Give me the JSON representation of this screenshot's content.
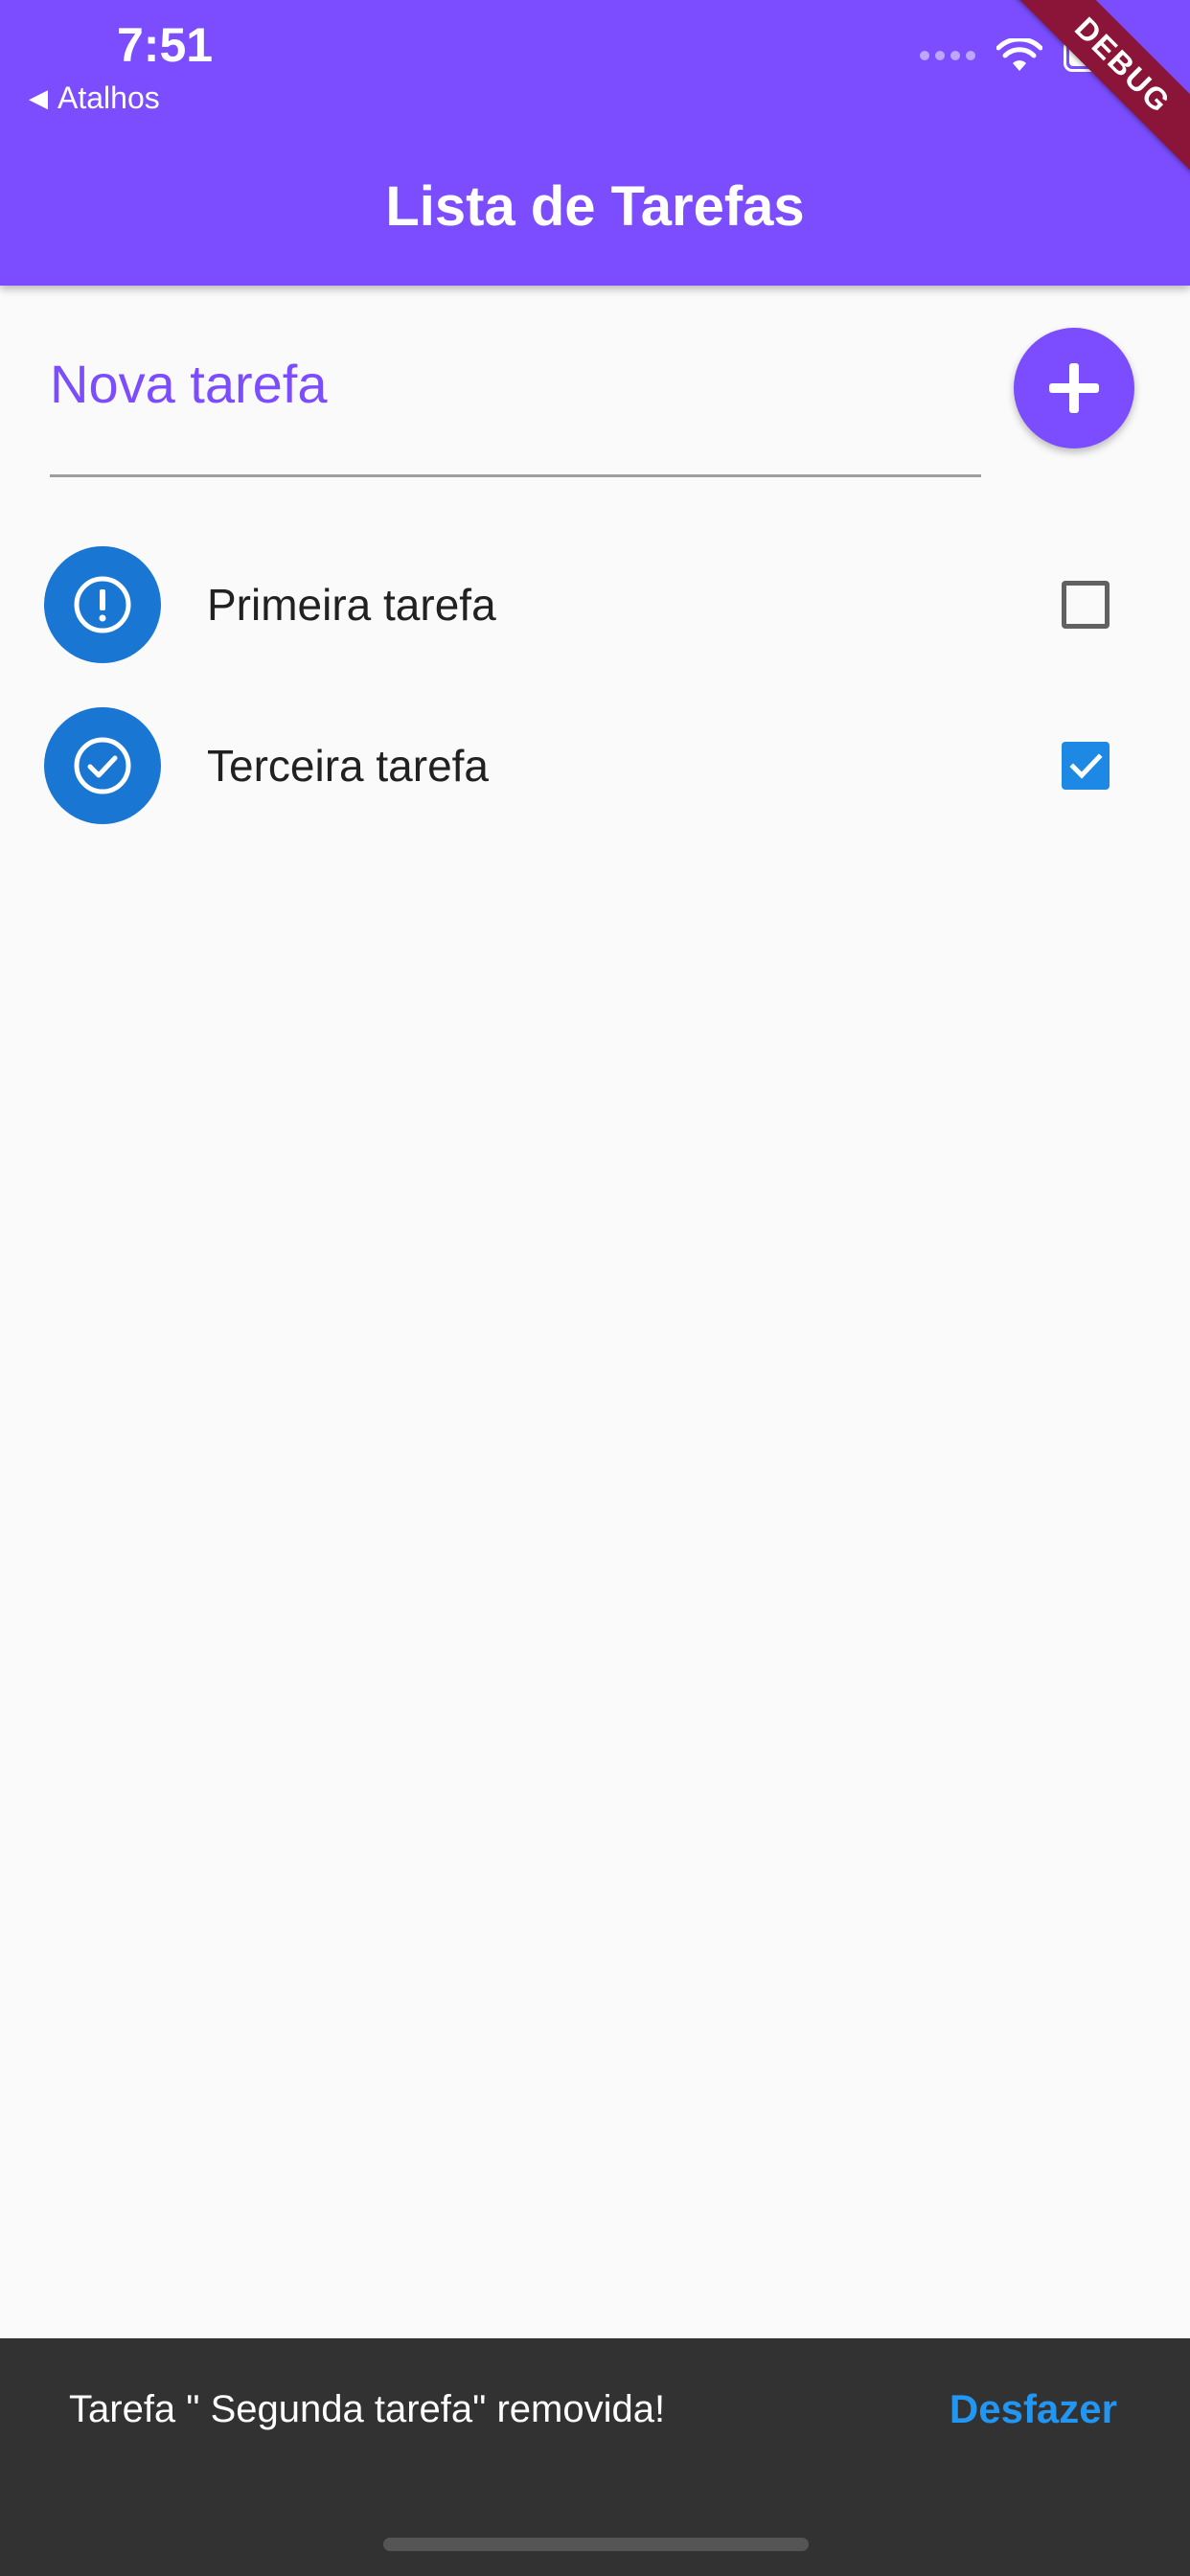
{
  "status_bar": {
    "time": "7:51",
    "back_label": "Atalhos",
    "back_icon": "back-triangle-icon"
  },
  "debug_banner": "DEBUG",
  "appbar": {
    "title": "Lista de Tarefas",
    "color": "#7c4dff"
  },
  "new_task": {
    "placeholder": "Nova tarefa",
    "value": "",
    "add_icon": "plus-icon"
  },
  "tasks": [
    {
      "label": "Primeira tarefa",
      "done": false,
      "icon": "exclamation-circle-icon"
    },
    {
      "label": "Terceira tarefa",
      "done": true,
      "icon": "check-circle-icon"
    }
  ],
  "snackbar": {
    "message": "Tarefa \" Segunda tarefa\" removida!",
    "action_label": "Desfazer",
    "action_color": "#2196f3"
  }
}
